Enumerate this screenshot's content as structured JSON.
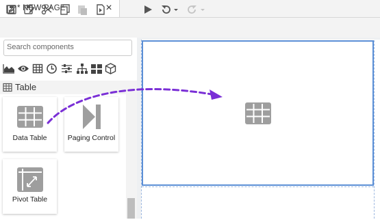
{
  "tab": {
    "label": "* NEW PAGE",
    "close": "×"
  },
  "search": {
    "placeholder": "Search components"
  },
  "section": {
    "label": "Table"
  },
  "components": [
    {
      "label": "Data Table"
    },
    {
      "label": "Paging Control"
    },
    {
      "label": "Pivot Table"
    }
  ],
  "icons": {
    "toolbar": [
      "save-icon",
      "save-as-icon",
      "cut-icon",
      "copy-icon",
      "paste-icon",
      "export-icon",
      "run-icon",
      "undo-icon",
      "redo-icon"
    ],
    "categories": [
      "area-chart-icon",
      "eye-icon",
      "table-grid-icon",
      "clock-icon",
      "sliders-icon",
      "hierarchy-icon",
      "dashboard-icon",
      "cube-icon"
    ]
  },
  "colors": {
    "accent": "#5b8fd6",
    "drag_arrow": "#7a2fd6",
    "icon_gray": "#9e9e9e"
  }
}
